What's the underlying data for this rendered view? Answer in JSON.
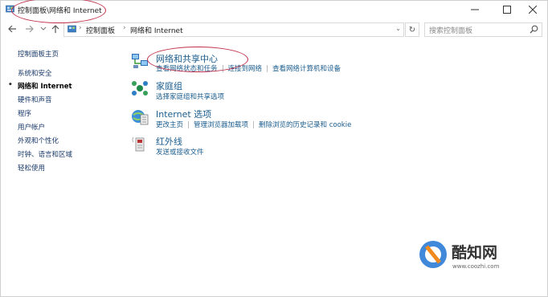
{
  "window": {
    "title": "控制面板\\网络和 Internet"
  },
  "address": {
    "crumbs": [
      "控制面板",
      "网络和 Internet"
    ],
    "dropdown_glyph": "⌄",
    "refresh_glyph": "↻"
  },
  "search": {
    "placeholder": "搜索控制面板"
  },
  "sidebar": {
    "items": [
      {
        "label": "控制面板主页",
        "active": false
      },
      {
        "label": "系统和安全",
        "active": false
      },
      {
        "label": "网络和 Internet",
        "active": true
      },
      {
        "label": "硬件和声音",
        "active": false
      },
      {
        "label": "程序",
        "active": false
      },
      {
        "label": "用户帐户",
        "active": false
      },
      {
        "label": "外观和个性化",
        "active": false
      },
      {
        "label": "时钟、语言和区域",
        "active": false
      },
      {
        "label": "轻松使用",
        "active": false
      }
    ]
  },
  "categories": [
    {
      "title": "网络和共享中心",
      "icon": "network-sharing-icon",
      "links": [
        "查看网络状态和任务",
        "连接到网络",
        "查看网络计算机和设备"
      ]
    },
    {
      "title": "家庭组",
      "icon": "homegroup-icon",
      "links": [
        "选择家庭组和共享选项"
      ]
    },
    {
      "title": "Internet 选项",
      "icon": "internet-options-icon",
      "links": [
        "更改主页",
        "管理浏览器加载项",
        "删除浏览的历史记录和 cookie"
      ]
    },
    {
      "title": "红外线",
      "icon": "infrared-icon",
      "links": [
        "发送或接收文件"
      ]
    }
  ],
  "watermark": {
    "name": "酷知网",
    "url": "www.coozhi.com"
  },
  "colors": {
    "link": "#1a5c8e",
    "annotation": "#c0304a",
    "watermark_blue": "#2b7bd6",
    "watermark_orange": "#f08a1c"
  }
}
